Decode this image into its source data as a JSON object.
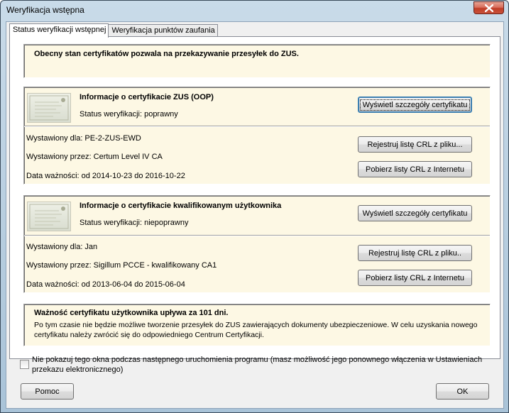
{
  "window": {
    "title": "Weryfikacja wstępna"
  },
  "tabs": [
    {
      "label": "Status weryfikacji wstępnej"
    },
    {
      "label": "Weryfikacja punktów zaufania"
    }
  ],
  "status_banner": {
    "text": "Obecny stan certyfikatów pozwala na przekazywanie przesyłek do ZUS."
  },
  "zus_cert": {
    "heading": "Informacje o certyfikacie ZUS (OOP)",
    "status": "Status weryfikacji: poprawny",
    "issued_to": "Wystawiony dla: PE-2-ZUS-EWD",
    "issued_by": "Wystawiony przez: Certum Level IV CA",
    "validity": "Data ważności: od 2014-10-23 do 2016-10-22",
    "details_button": "Wyświetl szczegóły certyfikatu",
    "register_crl_button": "Rejestruj listę CRL z pliku...",
    "download_crl_button": "Pobierz listy CRL z Internetu"
  },
  "user_cert": {
    "heading": "Informacje o certyfikacie kwalifikowanym użytkownika",
    "status": "Status weryfikacji: niepoprawny",
    "issued_to": "Wystawiony dla: Jan",
    "issued_by": "Wystawiony przez: Sigillum PCCE - kwalifikowany CA1",
    "validity": "Data ważności: od 2013-06-04 do 2015-06-04",
    "details_button": "Wyświetl szczegóły certyfikatu",
    "register_crl_button": "Rejestruj listę CRL z pliku..",
    "download_crl_button": "Pobierz listy CRL z Internetu"
  },
  "expiry_notice": {
    "heading": "Ważność certyfikatu użytkownika upływa za 101 dni.",
    "line1": "Po tym czasie nie będzie możliwe tworzenie przesyłek do ZUS zawierających dokumenty ubezpieczeniowe. W celu uzyskania nowego",
    "line2": "certyfikatu należy zwrócić się do odpowiedniego Centrum Certyfikacji."
  },
  "dont_show": {
    "line1": "Nie pokazuj tego okna podczas następnego uruchomienia programu (masz możliwość jego ponownego włączenia w Ustawieniach",
    "line2": "przekazu elektronicznego)"
  },
  "footer": {
    "help_button": "Pomoc",
    "ok_button": "OK"
  },
  "icons": {
    "close": "close-icon",
    "certificate": "certificate-icon"
  }
}
